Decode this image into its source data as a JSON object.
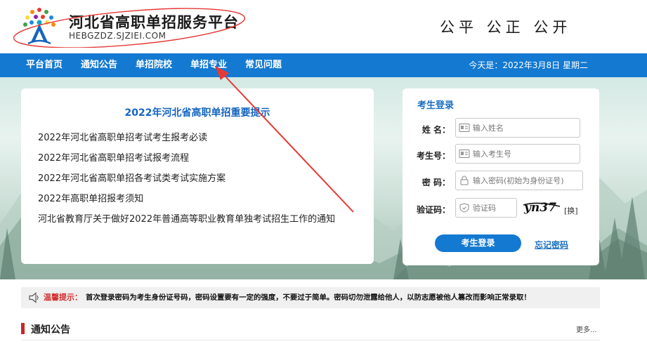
{
  "header": {
    "site_title": "河北省高职单招服务平台",
    "site_domain": "HEBGZDZ.SJZIEI.COM",
    "slogan": "公平  公正  公开"
  },
  "nav": {
    "items": [
      {
        "label": "平台首页"
      },
      {
        "label": "通知公告"
      },
      {
        "label": "单招院校"
      },
      {
        "label": "单招专业"
      },
      {
        "label": "常见问题"
      }
    ],
    "date_text": "今天是：2022年3月8日 星期二"
  },
  "tips": {
    "title": "2022年河北省高职单招重要提示",
    "links": [
      {
        "text": "2022年河北省高职单招考试考生报考必读"
      },
      {
        "text": "2022年河北省高职单招考试报考流程"
      },
      {
        "text": "2022年河北省高职单招各考试类考试实施方案"
      },
      {
        "text": "2022年高职单招报考须知"
      },
      {
        "text": "河北省教育厅关于做好2022年普通高等职业教育单独考试招生工作的通知"
      }
    ]
  },
  "login": {
    "title": "考生登录",
    "name_label": "姓   名：",
    "name_placeholder": "输入姓名",
    "id_label": "考生号：",
    "id_placeholder": "输入考生号",
    "password_label": "密   码：",
    "password_placeholder": "输入密码(初始为身份证号)",
    "captcha_label": "验证码：",
    "captcha_placeholder": "验证码",
    "captcha_image_text": "yn37",
    "captcha_switch": "[换]",
    "login_button": "考生登录",
    "forgot_link": "忘记密码"
  },
  "notice": {
    "label": "温馨提示：",
    "text": "首次登录密码为考生身份证号码，密码设置要有一定的强度，不要过于简单。密码切勿泄露给他人，以防志愿被他人篡改而影响正常录取！"
  },
  "section": {
    "title": "通知公告",
    "more": "更多..."
  },
  "colors": {
    "nav_bg": "#1479d1",
    "tips_title": "#1565c0",
    "notice_label": "#d32f2f",
    "annotation_red": "#e53935"
  },
  "icons": {
    "logo": "tree-logo-icon",
    "name_field": "id-card-icon",
    "id_field": "id-card-icon",
    "password_field": "lock-icon",
    "captcha_field": "shield-icon",
    "notice": "speaker-icon"
  }
}
